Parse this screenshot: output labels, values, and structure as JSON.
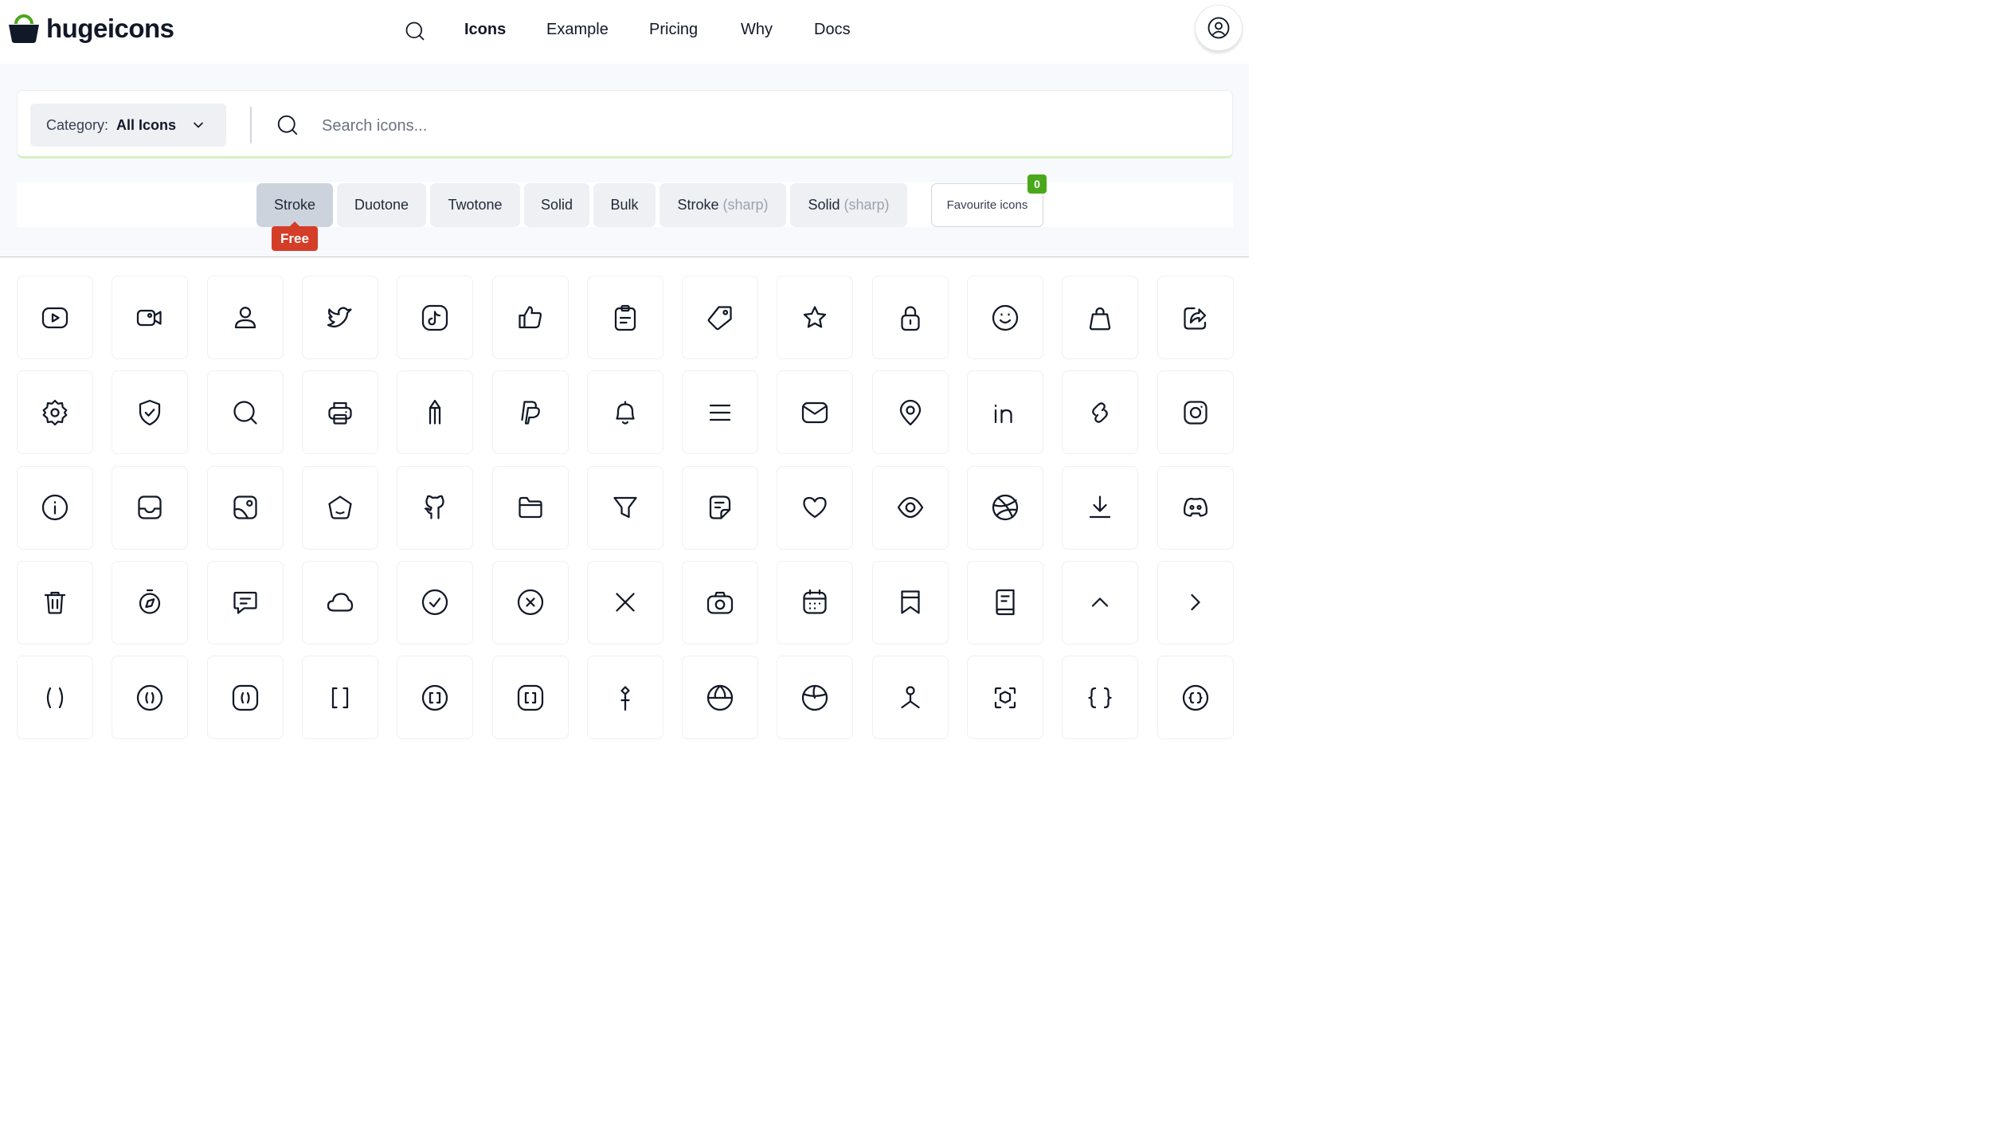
{
  "brand": {
    "name": "hugeicons",
    "logo_icon": "basket-logo-icon"
  },
  "nav": {
    "search_icon": "search-icon",
    "items": [
      "Icons",
      "Example",
      "Pricing",
      "Why",
      "Docs"
    ],
    "active": "Icons",
    "user_icon": "user-circle-icon"
  },
  "search": {
    "category_label": "Category:",
    "category_value": "All Icons",
    "placeholder": "Search icons..."
  },
  "style_tabs": [
    {
      "label": "Stroke",
      "suffix": "",
      "active": true
    },
    {
      "label": "Duotone",
      "suffix": ""
    },
    {
      "label": "Twotone",
      "suffix": ""
    },
    {
      "label": "Solid",
      "suffix": ""
    },
    {
      "label": "Bulk",
      "suffix": ""
    },
    {
      "label": "Stroke",
      "suffix": "(sharp)"
    },
    {
      "label": "Solid",
      "suffix": "(sharp)"
    }
  ],
  "free_badge": "Free",
  "favourites": {
    "label": "Favourite icons",
    "count": "0"
  },
  "colors": {
    "accent_green": "#4aa81b",
    "free_red": "#d43d27",
    "active_tab": "#ccd3dd"
  },
  "icons": [
    [
      "youtube",
      "video-camera",
      "user",
      "twitter",
      "tiktok",
      "thumbs-up",
      "clipboard",
      "tag",
      "star",
      "lock",
      "smile",
      "shopping-bag",
      "share"
    ],
    [
      "settings",
      "shield-check",
      "search",
      "printer",
      "pencil",
      "paypal",
      "notification",
      "menu",
      "mail",
      "location",
      "linkedin",
      "link",
      "instagram"
    ],
    [
      "information",
      "inbox",
      "image",
      "home",
      "github",
      "folder",
      "filter",
      "file",
      "favourite",
      "eye",
      "dribbble",
      "download",
      "discord"
    ],
    [
      "delete",
      "compass",
      "comment",
      "cloud",
      "check-circle",
      "cancel-circle",
      "cancel",
      "camera",
      "calendar",
      "bookmark",
      "book",
      "arrow-up",
      "arrow-right"
    ],
    [
      "bracket-round",
      "bracket-circle",
      "bracket-square-rounded",
      "bracket-square",
      "bracket-circle-2",
      "bracket-square-2",
      "pin",
      "globe",
      "globe-2",
      "hierarchy",
      "cube-scan",
      "curly-brackets",
      "curly-brackets-circle"
    ]
  ]
}
